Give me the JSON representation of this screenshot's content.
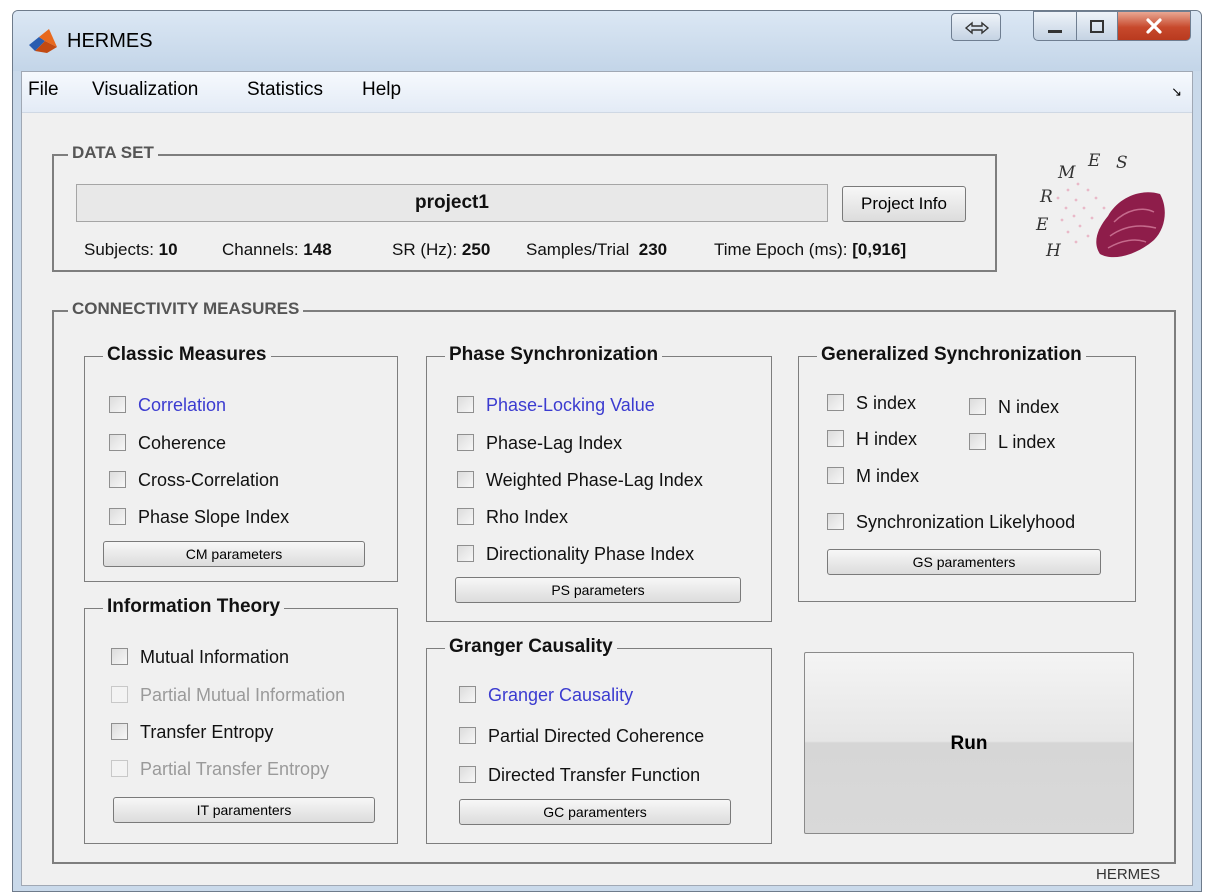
{
  "window": {
    "title": "HERMES"
  },
  "menu": {
    "items": [
      "File",
      "Visualization",
      "Statistics",
      "Help"
    ]
  },
  "dataset": {
    "title": "DATA SET",
    "project_name": "project1",
    "project_info_label": "Project Info",
    "stats": [
      {
        "label": "Subjects:",
        "value": "10"
      },
      {
        "label": "Channels:",
        "value": "148"
      },
      {
        "label": "SR (Hz):",
        "value": "250"
      },
      {
        "label": "Samples/Trial",
        "value": "230"
      },
      {
        "label": "Time Epoch (ms):",
        "value": "[0,916]"
      }
    ]
  },
  "logo": {
    "letters": "H.E.R.M.E.S"
  },
  "connectivity": {
    "title": "CONNECTIVITY MEASURES",
    "classic": {
      "title": "Classic Measures",
      "items": [
        "Correlation",
        "Coherence",
        "Cross-Correlation",
        "Phase Slope Index"
      ],
      "button": "CM parameters"
    },
    "phase": {
      "title": "Phase Synchronization",
      "items": [
        "Phase-Locking Value",
        "Phase-Lag Index",
        "Weighted Phase-Lag Index",
        "Rho Index",
        "Directionality Phase Index"
      ],
      "button": "PS parameters"
    },
    "generalized": {
      "title": "Generalized Synchronization",
      "items": [
        "S index",
        "N index",
        "H index",
        "L index",
        "M index",
        "Synchronization Likelyhood"
      ],
      "button": "GS paramenters"
    },
    "information": {
      "title": "Information Theory",
      "items": [
        "Mutual Information",
        "Partial Mutual Information",
        "Transfer Entropy",
        "Partial Transfer Entropy"
      ],
      "button": "IT paramenters"
    },
    "granger": {
      "title": "Granger Causality",
      "items": [
        "Granger Causality",
        "Partial Directed Coherence",
        "Directed Transfer Function"
      ],
      "button": "GC paramenters"
    },
    "run_label": "Run"
  },
  "footer": {
    "label": "HERMES"
  },
  "colors": {
    "link_blue": "#3b3bd0",
    "disabled_gray": "#9a9a9a",
    "close_red": "#c7492c"
  }
}
